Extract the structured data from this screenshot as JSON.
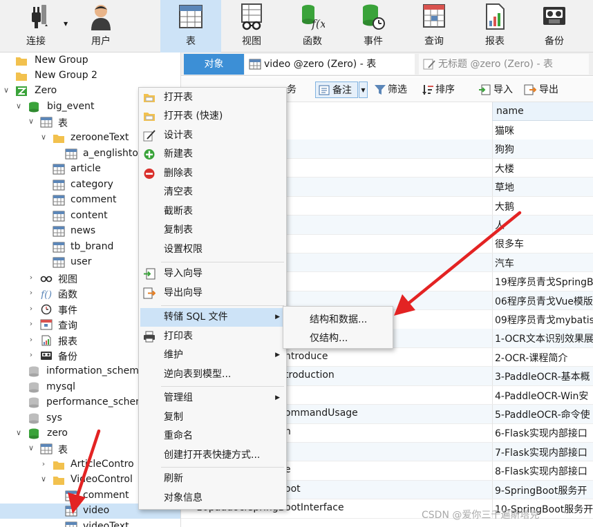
{
  "toolbar": {
    "items": [
      {
        "label": "连接",
        "icon": "plug-icon"
      },
      {
        "label": "用户",
        "icon": "user-icon"
      },
      {
        "label": "表",
        "icon": "table-icon"
      },
      {
        "label": "视图",
        "icon": "view-icon"
      },
      {
        "label": "函数",
        "icon": "function-icon"
      },
      {
        "label": "事件",
        "icon": "event-icon"
      },
      {
        "label": "查询",
        "icon": "query-icon"
      },
      {
        "label": "报表",
        "icon": "report-icon"
      },
      {
        "label": "备份",
        "icon": "backup-icon"
      }
    ],
    "active": "表"
  },
  "tree": {
    "items": [
      {
        "label": "New Group",
        "icon": "folder-icon"
      },
      {
        "label": "New Group 2",
        "icon": "folder-icon"
      },
      {
        "label": "Zero",
        "icon": "connection-icon"
      },
      {
        "label": "big_event",
        "icon": "database-icon"
      },
      {
        "label": "表",
        "icon": "table-icon"
      },
      {
        "label": "zerooneText",
        "icon": "folder-icon"
      },
      {
        "label": "a_englishto",
        "icon": "table-icon"
      },
      {
        "label": "article",
        "icon": "table-icon"
      },
      {
        "label": "category",
        "icon": "table-icon"
      },
      {
        "label": "comment",
        "icon": "table-icon"
      },
      {
        "label": "content",
        "icon": "table-icon"
      },
      {
        "label": "news",
        "icon": "table-icon"
      },
      {
        "label": "tb_brand",
        "icon": "table-icon"
      },
      {
        "label": "user",
        "icon": "table-icon"
      },
      {
        "label": "视图",
        "icon": "view-icon"
      },
      {
        "label": "函数",
        "icon": "function-icon"
      },
      {
        "label": "事件",
        "icon": "event-icon"
      },
      {
        "label": "查询",
        "icon": "query-icon"
      },
      {
        "label": "报表",
        "icon": "report-icon"
      },
      {
        "label": "备份",
        "icon": "backup-icon"
      },
      {
        "label": "information_schema",
        "icon": "database-icon"
      },
      {
        "label": "mysql",
        "icon": "database-icon"
      },
      {
        "label": "performance_schema",
        "icon": "database-icon"
      },
      {
        "label": "sys",
        "icon": "database-icon"
      },
      {
        "label": "zero",
        "icon": "database-icon"
      },
      {
        "label": "表",
        "icon": "table-icon"
      },
      {
        "label": "ArticleContro",
        "icon": "folder-icon"
      },
      {
        "label": "VideoControl",
        "icon": "folder-icon"
      },
      {
        "label": "comment",
        "icon": "table-icon"
      },
      {
        "label": "video",
        "icon": "table-icon"
      },
      {
        "label": "videoText",
        "icon": "table-icon"
      }
    ]
  },
  "tabs": {
    "objects": "对象",
    "video": "video @zero (Zero) - 表",
    "untitled": "无标题 @zero (Zero) - 表"
  },
  "subtoolbar": {
    "partial": "务",
    "note": "备注",
    "filter": "筛选",
    "sort": "排序",
    "import": "导入",
    "export": "导出"
  },
  "grid": {
    "header_name": "name",
    "rows": [
      {
        "c1": "",
        "name": "猫咪"
      },
      {
        "c1": "",
        "name": "狗狗"
      },
      {
        "c1": "",
        "name": "大楼"
      },
      {
        "c1": "",
        "name": "草地"
      },
      {
        "c1": "",
        "name": "大鹅"
      },
      {
        "c1": "",
        "name": "人"
      },
      {
        "c1": "",
        "name": "很多车"
      },
      {
        "c1": "",
        "name": "汽车"
      },
      {
        "c1": "",
        "name": "19程序员青戈SpringB"
      },
      {
        "c1": "",
        "name": "06程序员青戈Vue模版"
      },
      {
        "c1": "",
        "name": "09程序员青戈mybatis"
      },
      {
        "c1": "",
        "name": "1-OCR文本识别效果展"
      },
      {
        "c1": "ntroduce",
        "name": "2-OCR-课程简介"
      },
      {
        "c1": "troduction",
        "name": "3-PaddleOCR-基本概"
      },
      {
        "c1": "",
        "name": "4-PaddleOCR-Win安"
      },
      {
        "c1": "ommandUsage",
        "name": "5-PaddleOCR-命令使"
      },
      {
        "c1": "n",
        "name": "6-Flask实现内部接口"
      },
      {
        "c1": "",
        "name": "7-Flask实现内部接口"
      },
      {
        "c1": "e",
        "name": "8-Flask实现内部接口"
      },
      {
        "c1": "oot",
        "name": "9-SpringBoot服务开"
      },
      {
        "c1": "10paddocrspringBootInterface",
        "name": "10-SpringBoot服务开"
      }
    ]
  },
  "context_menu": {
    "items": [
      {
        "label": "打开表",
        "icon": "open-folder-icon"
      },
      {
        "label": "打开表 (快速)",
        "icon": "open-folder-icon"
      },
      {
        "label": "设计表",
        "icon": "design-pencil-icon"
      },
      {
        "label": "新建表",
        "icon": "add-icon"
      },
      {
        "label": "删除表",
        "icon": "delete-icon"
      },
      {
        "label": "清空表",
        "icon": ""
      },
      {
        "label": "截断表",
        "icon": ""
      },
      {
        "label": "复制表",
        "icon": ""
      },
      {
        "label": "设置权限",
        "icon": ""
      },
      {
        "label": "导入向导",
        "icon": "import-icon"
      },
      {
        "label": "导出向导",
        "icon": "export-icon"
      },
      {
        "label": "转储 SQL 文件",
        "icon": ""
      },
      {
        "label": "打印表",
        "icon": "printer-icon"
      },
      {
        "label": "维护",
        "icon": ""
      },
      {
        "label": "逆向表到模型...",
        "icon": ""
      },
      {
        "label": "管理组",
        "icon": ""
      },
      {
        "label": "复制",
        "icon": ""
      },
      {
        "label": "重命名",
        "icon": ""
      },
      {
        "label": "创建打开表快捷方式...",
        "icon": ""
      },
      {
        "label": "刷新",
        "icon": ""
      },
      {
        "label": "对象信息",
        "icon": ""
      }
    ]
  },
  "submenu": {
    "items": [
      "结构和数据...",
      "仅结构..."
    ]
  },
  "watermark": "CSDN @爱你三千遍斯塔克",
  "colors": {
    "highlight": "#cde3f7",
    "arrow": "#e32323",
    "green": "#3aa33a",
    "folder": "#f2c14e"
  }
}
